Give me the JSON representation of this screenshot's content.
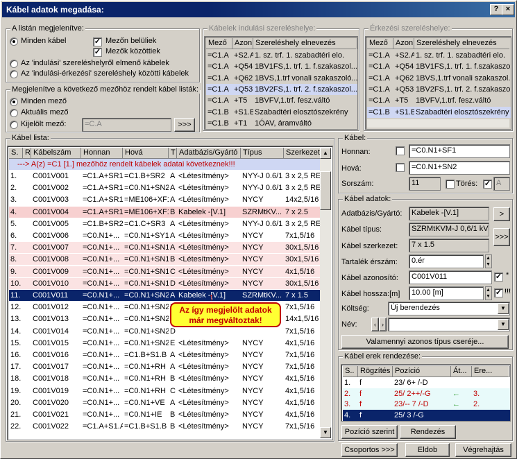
{
  "window": {
    "title": "Kábel adatok megadása:",
    "help": "?",
    "close": "×"
  },
  "filter": {
    "title": "A listán megjelenítve:",
    "all": "Minden kábel",
    "field_in": "Mezőn belüliek",
    "field_between": "Mezők közöttiek",
    "from_start": "Az 'indulási' szereléshelyről elmenő kábelek",
    "between": "Az 'indulási-érkezési' szereléshely közötti kábelek"
  },
  "assign": {
    "title": "Megjelenítve a következő mezőhöz rendelt kábel listák:",
    "all": "Minden mező",
    "current": "Aktuális mező",
    "selected": "Kijelölt mező:",
    "selected_value": "=C.A",
    "more": ">>>"
  },
  "start_loc": {
    "title": "Kábelek indulási szereléshelye:",
    "headers": [
      "Mező",
      "Azon.",
      "Szereléshely elnevezés"
    ],
    "rows": [
      [
        "=C1.A",
        "+S2.A",
        "1. sz. trf. 1. szabadtéri elo."
      ],
      [
        "=C1.A",
        "+Q54",
        "1BV1FS,1. trf. 1. f.szakaszol..."
      ],
      [
        "=C1.A",
        "+Q62",
        "1BVS,1.trf vonali szakaszoló..."
      ],
      [
        "=C1.A",
        "+Q53",
        "1BV2FS,1. trf. 2. f.szakaszol..."
      ],
      [
        "=C1.A",
        "+T5",
        "1BVFV,1.trf. fesz.váltó"
      ],
      [
        "=C1.B",
        "+S1.B",
        "Szabadtéri elosztószekrény"
      ],
      [
        "=C1.B",
        "+T1",
        "1ÓAV, áramváltó"
      ]
    ]
  },
  "end_loc": {
    "title": "Érkezési szereléshelye:",
    "headers": [
      "Mező",
      "Azon.",
      "Szereléshely elnevezés"
    ],
    "rows": [
      [
        "=C1.A",
        "+S2.A",
        "1. sz. trf. 1. szabadtéri elo."
      ],
      [
        "=C1.A",
        "+Q54",
        "1BV1FS,1. trf. 1. f.szakaszol..."
      ],
      [
        "=C1.A",
        "+Q62",
        "1BVS,1.trf vonali szakaszol..."
      ],
      [
        "=C1.A",
        "+Q53",
        "1BV2FS,1. trf. 2. f.szakaszol..."
      ],
      [
        "=C1.A",
        "+T5",
        "1BVFV,1.trf. fesz.váltó"
      ],
      [
        "=C1.B",
        "+S1.B",
        "Szabadtéri elosztószekrény ..."
      ]
    ]
  },
  "cable_list": {
    "title": "Kábel lista:",
    "headers": [
      "S.",
      "R",
      "Kábelszám",
      "Honnan",
      "Hová",
      "T",
      "Adatbázis/Gyártó",
      "Típus",
      "Szerkezet"
    ],
    "notice": "---> A(z) =C1 [1.] mezőhöz rendelt kábelek adatai következnek!!!",
    "rows": [
      [
        "1.",
        "",
        "C001V001",
        "=C1.A+SR1",
        "=C1.B+SR2",
        "A",
        "<Létesítmény>",
        "NYY-J 0.6/1",
        "3 x 2,5 RE"
      ],
      [
        "2.",
        "",
        "C001V002",
        "=C1.A+SR1",
        "=C0.N1+SN2",
        "A",
        "<Létesítmény>",
        "NYY-J 0.6/1",
        "3 x 2,5 RE"
      ],
      [
        "3.",
        "",
        "C001V003",
        "=C1.A+SR1",
        "=ME106+XF1",
        "A",
        "<Létesítmény>",
        "NYCY",
        "14x2,5/16"
      ],
      [
        "4.",
        "",
        "C001V004",
        "=C1.A+SR1",
        "=ME106+XF1",
        "B",
        "Kabelek -[V.1]",
        "SZRMtKV...",
        "7 x 2.5"
      ],
      [
        "5.",
        "",
        "C001V005",
        "=C1.B+SR2",
        "=C1.C+SR3",
        "A",
        "<Létesítmény>",
        "NYY-J 0.6/1",
        "3 x 2,5 RE"
      ],
      [
        "6.",
        "",
        "C001V006",
        "=C0.N1+...",
        "=C0.N1+SY1",
        "A",
        "<Létesítmény>",
        "NYCY",
        "7x1,5/16"
      ],
      [
        "7.",
        "",
        "C001V007",
        "=C0.N1+...",
        "=C0.N1+SN1",
        "A",
        "<Létesítmény>",
        "NYCY",
        "30x1,5/16"
      ],
      [
        "8.",
        "",
        "C001V008",
        "=C0.N1+...",
        "=C0.N1+SN1",
        "B",
        "<Létesítmény>",
        "NYCY",
        "30x1,5/16"
      ],
      [
        "9.",
        "",
        "C001V009",
        "=C0.N1+...",
        "=C0.N1+SN1",
        "C",
        "<Létesítmény>",
        "NYCY",
        "4x1,5/16"
      ],
      [
        "10.",
        "",
        "C001V010",
        "=C0.N1+...",
        "=C0.N1+SN1",
        "D",
        "<Létesítmény>",
        "NYCY",
        "30x1,5/16"
      ],
      [
        "11.",
        "",
        "C001V011",
        "=C0.N1+...",
        "=C0.N1+SN2",
        "A",
        "Kabelek -[V.1]",
        "SZRMtKV...",
        "7 x 1.5"
      ],
      [
        "12.",
        "",
        "C001V012",
        "=C0.N1+...",
        "=C0.N1+SN2",
        "B",
        "<Létesítmény>",
        "NYCY",
        "7x1,5/16"
      ],
      [
        "13.",
        "",
        "C001V013",
        "=C0.N1+...",
        "=C0.N1+SN2",
        "C",
        "",
        "",
        "14x1,5/16"
      ],
      [
        "14.",
        "",
        "C001V014",
        "=C0.N1+...",
        "=C0.N1+SN2",
        "D",
        "",
        "",
        "7x1,5/16"
      ],
      [
        "15.",
        "",
        "C001V015",
        "=C0.N1+...",
        "=C0.N1+SN2",
        "E",
        "<Létesítmény>",
        "NYCY",
        "4x1,5/16"
      ],
      [
        "16.",
        "",
        "C001V016",
        "=C0.N1+...",
        "=C1.B+S1.B",
        "A",
        "<Létesítmény>",
        "NYCY",
        "7x1,5/16"
      ],
      [
        "17.",
        "",
        "C001V017",
        "=C0.N1+...",
        "=C0.N1+RH",
        "A",
        "<Létesítmény>",
        "NYCY",
        "7x1,5/16"
      ],
      [
        "18.",
        "",
        "C001V018",
        "=C0.N1+...",
        "=C0.N1+RH",
        "B",
        "<Létesítmény>",
        "NYCY",
        "4x1,5/16"
      ],
      [
        "19.",
        "",
        "C001V019",
        "=C0.N1+...",
        "=C0.N1+RH",
        "C",
        "<Létesítmény>",
        "NYCY",
        "4x1,5/16"
      ],
      [
        "20.",
        "",
        "C001V020",
        "=C0.N1+...",
        "=C0.N1+VE",
        "A",
        "<Létesítmény>",
        "NYCY",
        "4x1,5/16"
      ],
      [
        "21.",
        "",
        "C001V021",
        "=C0.N1+...",
        "=C0.N1+IE",
        "B",
        "<Létesítmény>",
        "NYCY",
        "4x1,5/16"
      ],
      [
        "22.",
        "",
        "C001V022",
        "=C1.A+S1.A",
        "=C1.B+S1.B",
        "B",
        "<Létesítmény>",
        "NYCY",
        "7x1,5/16"
      ]
    ],
    "tooltip_line1": "Az így megjelölt adatok",
    "tooltip_line2": "már megváltoztak!"
  },
  "cable": {
    "title": "Kábel:",
    "from_label": "Honnan:",
    "from_value": "=C0.N1+SF1",
    "to_label": "Hová:",
    "to_value": "=C0.N1+SN2",
    "serial_label": "Sorszám:",
    "serial_value": "11",
    "delete_label": "Törés:",
    "delete_value": "A"
  },
  "cable_data": {
    "title": "Kábel adatok:",
    "db_label": "Adatbázis/Gyártó:",
    "db_value": "Kabelek -[V.1]",
    "type_label": "Kábel típus:",
    "type_value": "SZRMtKVM-J 0,6/1 kV",
    "struct_label": "Kábel szerkezet:",
    "struct_value": "7 x 1.5",
    "reserve_label": "Tartalék érszám:",
    "reserve_value": "0.ér",
    "id_label": "Kábel azonosító:",
    "id_value": "C001V011",
    "id_mark": "*",
    "length_label": "Kábel hossza:[m]",
    "length_value": "10.00 [m]",
    "length_mark": "!!!",
    "cost_label": "Költség:",
    "cost_value": "Új berendezés",
    "name_label": "Név:",
    "replace_button": "Valamennyi azonos típus cseréje...",
    "nav_single": ">",
    "nav_more": ">>>"
  },
  "cores": {
    "title": "Kábel erek rendezése:",
    "headers": [
      "S..",
      "Rögzítés",
      "Pozíció",
      "Át...",
      "Ere..."
    ],
    "rows": [
      [
        "1.",
        "f",
        "23/  6+ /-D",
        "",
        ""
      ],
      [
        "2.",
        "f",
        "25/  2++/-G",
        "←",
        "3."
      ],
      [
        "3.",
        "f",
        "23/-- 7 /-D",
        "←",
        "2."
      ],
      [
        "4.",
        "f",
        "25/  3 /-G",
        "",
        ""
      ]
    ],
    "pos_button": "Pozíció szerint",
    "sort_button": "Rendezés"
  },
  "footer": {
    "group": "Csoportos >>>",
    "drop": "Eldob",
    "run": "Végrehajtás"
  }
}
